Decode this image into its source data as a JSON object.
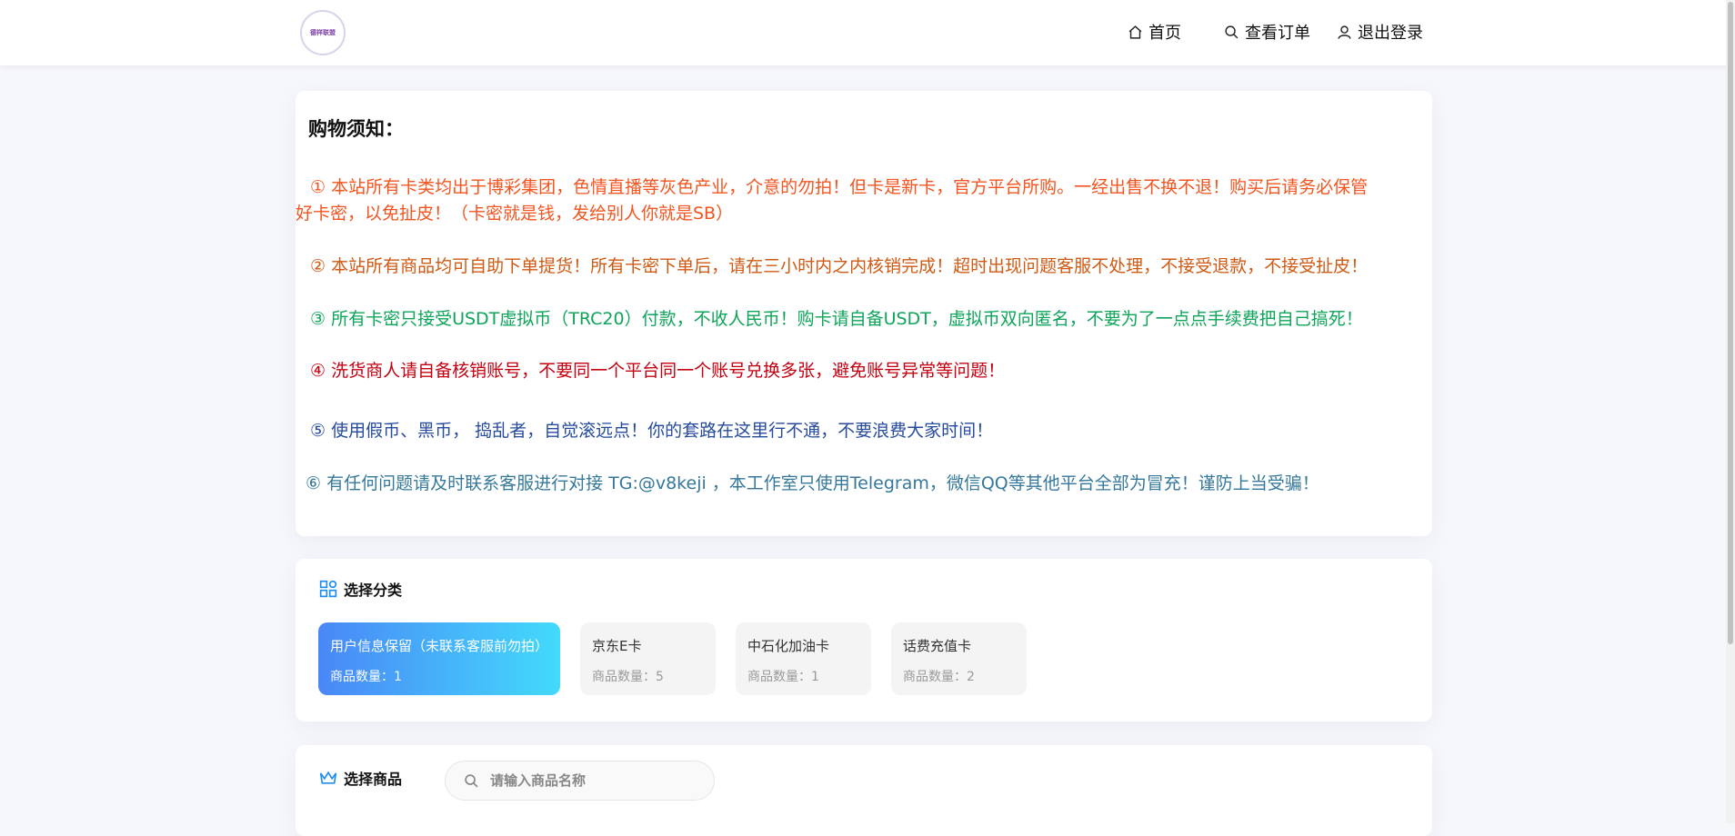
{
  "header": {
    "logo_text": "德祥联盟",
    "nav": {
      "home": "首页",
      "orders": "查看订单",
      "logout": "退出登录"
    }
  },
  "notice": {
    "title": "购物须知：",
    "items": [
      {
        "line1": "① 本站所有卡类均出于博彩集团，色情直播等灰色产业，介意的勿拍！但卡是新卡，官方平台所购。一经出售不换不退！购买后请务必保管",
        "line2": "好卡密，以免扯皮！（卡密就是钱，发给别人你就是SB）",
        "color": "#f4541f"
      },
      {
        "text": "②  本站所有商品均可自助下单提货！所有卡密下单后，请在三小时内之内核销完成！超时出现问题客服不处理，不接受退款，不接受扯皮！",
        "color": "#cf5a14"
      },
      {
        "text": "③  所有卡密只接受USDT虚拟币（TRC20）付款，不收人民币！购卡请自备USDT，虚拟币双向匿名，不要为了一点点手续费把自己搞死！",
        "color": "#0ea45a"
      },
      {
        "text": "④  洗货商人请自备核销账号，不要同一个平台同一个账号兑换多张，避免账号异常等问题！",
        "color": "#c40010"
      },
      {
        "text": "⑤  使用假币、黑币， 捣乱者，自觉滚远点！你的套路在这里行不通，不要浪费大家时间！",
        "color": "#274b9c"
      },
      {
        "text": "⑥  有任何问题请及时联系客服进行对接  TG:@v8keji ，本工作室只使用Telegram，微信QQ等其他平台全部为冒充！谨防上当受骗！",
        "color": "#35789a"
      }
    ]
  },
  "categories": {
    "title": "选择分类",
    "items": [
      {
        "name": "用户信息保留（未联系客服前勿拍）",
        "count": "商品数量：1",
        "active": true
      },
      {
        "name": "京东E卡",
        "count": "商品数量：5",
        "active": false
      },
      {
        "name": "中石化加油卡",
        "count": "商品数量：1",
        "active": false
      },
      {
        "name": "话费充值卡",
        "count": "商品数量：2",
        "active": false
      }
    ]
  },
  "goods": {
    "title": "选择商品",
    "search_placeholder": "请输入商品名称"
  },
  "colors": {
    "accent_gradient_start": "#4a87f7",
    "accent_gradient_end": "#43dafb",
    "page_background": "#f6f7fb"
  },
  "icons": {
    "home": "home-icon",
    "orders": "search-icon",
    "logout": "user-icon",
    "categories": "grid-icon",
    "goods": "crown-icon",
    "search": "search-icon"
  }
}
